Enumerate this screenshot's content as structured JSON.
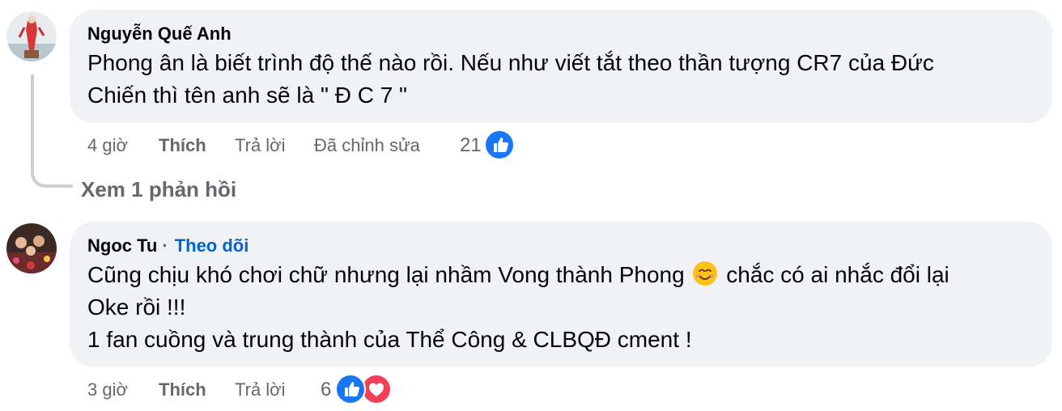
{
  "comments": [
    {
      "author": "Nguyễn Quế Anh",
      "lines": [
        "Phong ân là biết trình độ thế nào rồi. Nếu như viết tắt theo thần tượng CR7 của Đức",
        "Chiến thì tên anh sẽ là \" Đ C 7 \""
      ],
      "time": "4 giờ",
      "like_label": "Thích",
      "reply_label": "Trả lời",
      "edited_label": "Đã chỉnh sửa",
      "reaction_count": "21",
      "view_replies": "Xem 1 phản hồi"
    },
    {
      "author": "Ngoc Tu",
      "separator": "·",
      "follow_label": "Theo dõi",
      "line1_before": "Cũng chịu khó chơi chữ nhưng lại nhầm Vong thành Phong",
      "line1_after": "chắc có ai nhắc đổi lại",
      "line2": "Oke rồi !!!",
      "line3": "1 fan cuồng và trung thành của Thể Công & CLBQĐ cment !",
      "time": "3 giờ",
      "like_label": "Thích",
      "reply_label": "Trả lời",
      "reaction_count": "6"
    }
  ],
  "colors": {
    "bubble": "#f0f2f5",
    "meta_text": "#65676b",
    "follow_link": "#0064d1",
    "like_blue": "#1877f2",
    "love_red": "#f33e58"
  },
  "icons": [
    "avatar",
    "like-reaction-icon",
    "love-reaction-icon",
    "smiling-emoji-icon"
  ]
}
